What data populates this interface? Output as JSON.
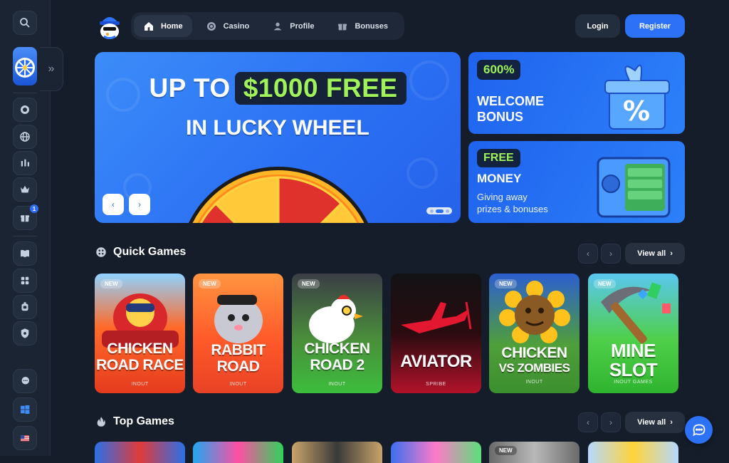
{
  "sidebar": {
    "icons": [
      "search-icon",
      "promo-wheel",
      "casino-chip-icon",
      "globe-icon",
      "sports-stats-icon",
      "crown-icon",
      "gift-icon",
      "book-icon",
      "puzzle-icon",
      "support-icon",
      "shield-icon",
      "chat-bubbles-icon",
      "windows-icon",
      "us-flag-icon"
    ],
    "gift_badge": "1"
  },
  "nav": {
    "items": [
      {
        "label": "Home",
        "icon": "home-icon",
        "active": true
      },
      {
        "label": "Casino",
        "icon": "chip-icon",
        "active": false
      },
      {
        "label": "Profile",
        "icon": "user-icon",
        "active": false
      },
      {
        "label": "Bonuses",
        "icon": "gift-icon",
        "active": false
      }
    ],
    "login": "Login",
    "register": "Register"
  },
  "hero": {
    "line1_prefix": "UP TO",
    "line1_highlight": "$1000 FREE",
    "line2": "IN LUCKY WHEEL",
    "prev": "‹",
    "next": "›"
  },
  "promos": [
    {
      "tag": "600%",
      "title_line1": "WELCOME",
      "title_line2": "BONUS"
    },
    {
      "tag": "FREE",
      "title_line1": "MONEY",
      "sub_line1": "Giving away",
      "sub_line2": "prizes & bonuses"
    }
  ],
  "quick_games": {
    "title": "Quick Games",
    "view_all": "View all",
    "games": [
      {
        "title1": "CHICKEN",
        "title2": "ROAD RACE",
        "provider": "INOUT",
        "new": "NEW"
      },
      {
        "title1": "RABBIT",
        "title2": "ROAD",
        "provider": "INOUT",
        "new": "NEW"
      },
      {
        "title1": "CHICKEN",
        "title2": "ROAD 2",
        "provider": "INOUT",
        "new": "NEW"
      },
      {
        "title1": "AVIATOR",
        "title2": "",
        "provider": "SPRIBE",
        "new": ""
      },
      {
        "title1": "CHICKEN",
        "title2": "VS ZOMBIES",
        "provider": "INOUT",
        "new": "NEW"
      },
      {
        "title1": "MINE",
        "title2": "SLOT",
        "provider": "INOUT GAMES",
        "new": "NEW"
      }
    ]
  },
  "top_games": {
    "title": "Top Games",
    "view_all": "View all",
    "new_label": "NEW"
  },
  "colors": {
    "background": "#151d2a",
    "accent": "#2d71f7",
    "highlight_green": "#9ff25a"
  }
}
